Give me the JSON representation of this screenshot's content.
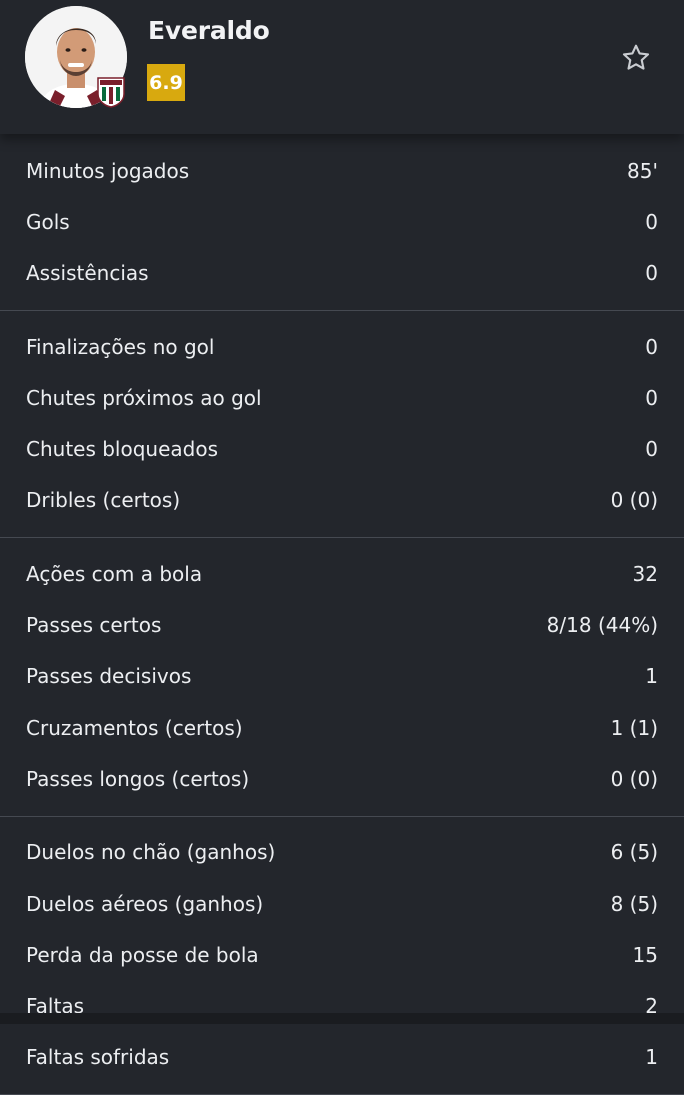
{
  "player": {
    "name": "Everaldo",
    "rating": "6.9",
    "icons": {
      "avatar": "player-photo",
      "crest": "club-crest-icon",
      "favorite": "star-outline-icon"
    }
  },
  "colors": {
    "background": "#23262c",
    "rating_badge": "#d8a90f",
    "divider": "#454951",
    "text": "#eceef1"
  },
  "groups": [
    {
      "rows": [
        {
          "label": "Minutos jogados",
          "value": "85'"
        },
        {
          "label": "Gols",
          "value": "0"
        },
        {
          "label": "Assistências",
          "value": "0"
        }
      ]
    },
    {
      "rows": [
        {
          "label": "Finalizações no gol",
          "value": "0"
        },
        {
          "label": "Chutes próximos ao gol",
          "value": "0"
        },
        {
          "label": "Chutes bloqueados",
          "value": "0"
        },
        {
          "label": "Dribles (certos)",
          "value": "0 (0)"
        }
      ]
    },
    {
      "rows": [
        {
          "label": "Ações com a bola",
          "value": "32"
        },
        {
          "label": "Passes certos",
          "value": "8/18 (44%)"
        },
        {
          "label": "Passes decisivos",
          "value": "1"
        },
        {
          "label": "Cruzamentos (certos)",
          "value": "1 (1)"
        },
        {
          "label": "Passes longos (certos)",
          "value": "0 (0)"
        }
      ]
    },
    {
      "rows": [
        {
          "label": "Duelos no chão (ganhos)",
          "value": "6 (5)"
        },
        {
          "label": "Duelos aéreos (ganhos)",
          "value": "8 (5)"
        },
        {
          "label": "Perda da posse de bola",
          "value": "15"
        },
        {
          "label": "Faltas",
          "value": "2"
        },
        {
          "label": "Faltas sofridas",
          "value": "1"
        }
      ]
    }
  ]
}
